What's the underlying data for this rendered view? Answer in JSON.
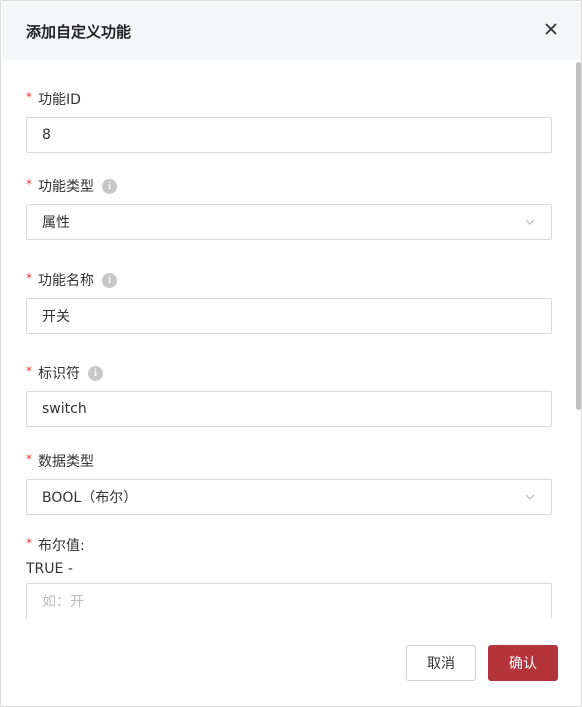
{
  "dialog": {
    "title": "添加自定义功能"
  },
  "fields": {
    "func_id": {
      "label": "功能ID",
      "value": "8"
    },
    "func_type": {
      "label": "功能类型",
      "value": "属性"
    },
    "func_name": {
      "label": "功能名称",
      "value": "开关"
    },
    "identifier": {
      "label": "标识符",
      "value": "switch"
    },
    "data_type": {
      "label": "数据类型",
      "value": "BOOL（布尔）"
    },
    "bool_value": {
      "label": "布尔值:",
      "true_label": "TRUE -",
      "placeholder": "如：开"
    }
  },
  "required_mark": "*",
  "info_glyph": "i",
  "footer": {
    "cancel_label": "取消",
    "confirm_label": "确认"
  },
  "colors": {
    "header_bg": "#f5f6f8",
    "primary": "#b3343a",
    "required": "#e53935"
  }
}
